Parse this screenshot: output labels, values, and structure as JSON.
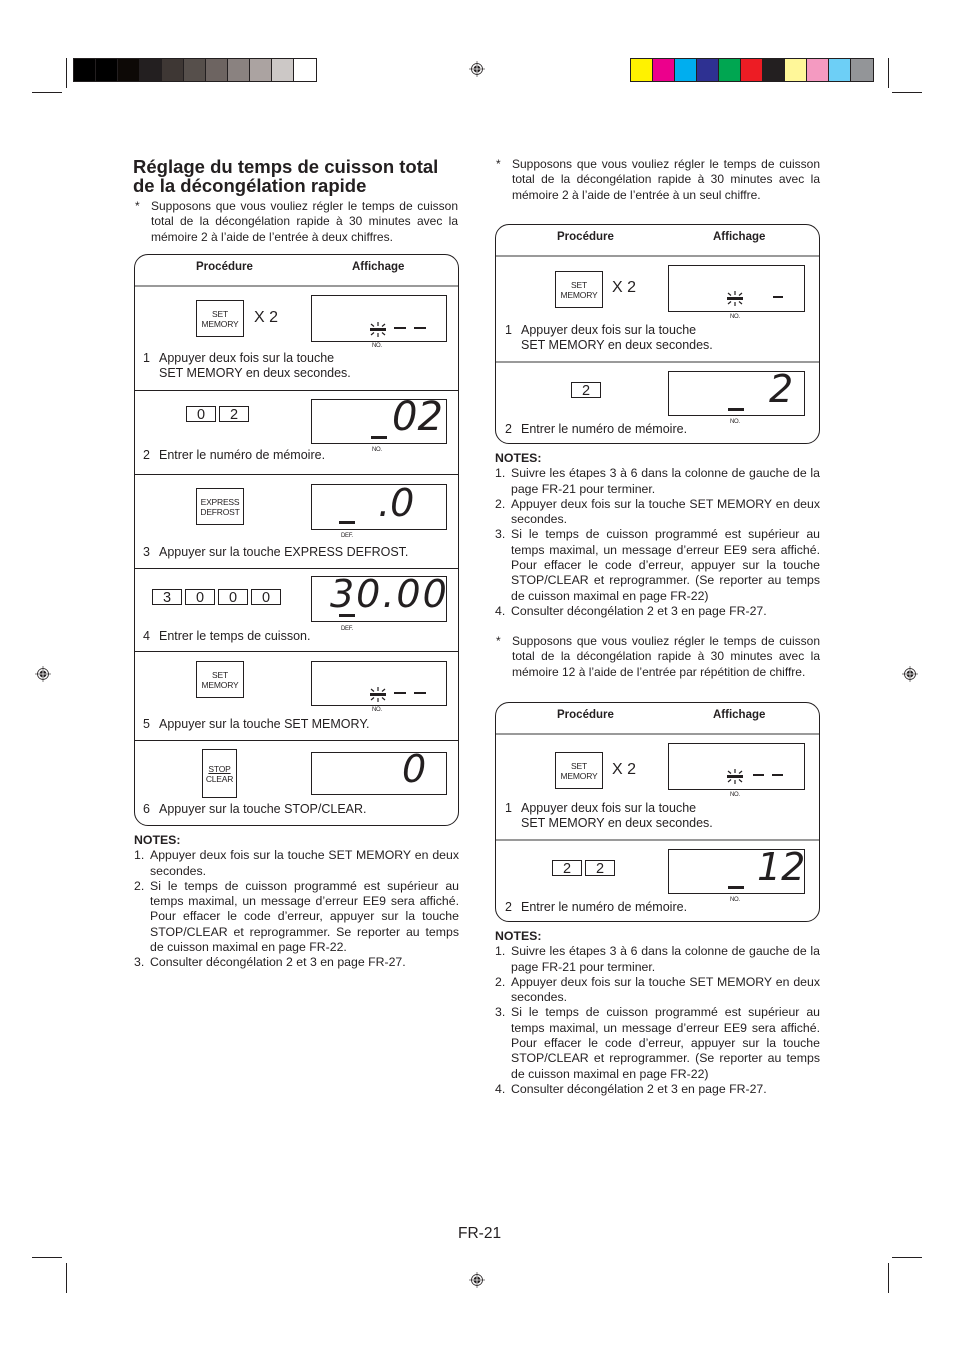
{
  "print_marks": {
    "gray_swatches": [
      "#000000",
      "#000000",
      "#0d0906",
      "#231f20",
      "#3e3734",
      "#564f4b",
      "#6d6461",
      "#8a8280",
      "#aba3a1",
      "#ccc8c6",
      "#ffffff"
    ],
    "color_swatches": [
      "#fff200",
      "#ec008c",
      "#00aeef",
      "#2e3192",
      "#00a651",
      "#ed1c24",
      "#231f20",
      "#fff799",
      "#f49ac1",
      "#6dcff6",
      "#939598"
    ]
  },
  "left": {
    "title": "Réglage du temps de cuisson total de la décongélation rapide",
    "intro_star": "*",
    "intro": "Supposons que vous vouliez régler le temps de cuisson total de la décongélation rapide à 30 minutes avec la mémoire 2 à l’aide de l’entrée à deux chiffres.",
    "table": {
      "col_procedure": "Procédure",
      "col_display": "Affichage",
      "steps": [
        {
          "key": [
            "SET",
            "MEMORY"
          ],
          "multiplier": "X 2",
          "display": "blink--",
          "label": "NO.",
          "num": "1",
          "text1": "Appuyer deux fois sur la touche",
          "text2": "SET MEMORY en deux secondes."
        },
        {
          "digits": [
            "0",
            "2"
          ],
          "display": "02",
          "label": "NO.",
          "num": "2",
          "text1": "Entrer le numéro de mémoire."
        },
        {
          "key": [
            "EXPRESS",
            "DEFROST"
          ],
          "display": ".0",
          "label": "DEF.",
          "num": "3",
          "text1": "Appuyer sur la touche EXPRESS DEFROST."
        },
        {
          "digits": [
            "3",
            "0",
            "0",
            "0"
          ],
          "display": "30.00",
          "label": "DEF.",
          "num": "4",
          "text1": "Entrer le temps de cuisson."
        },
        {
          "key": [
            "SET",
            "MEMORY"
          ],
          "display": "blink--",
          "label": "NO.",
          "num": "5",
          "text1": "Appuyer sur la touche SET MEMORY."
        },
        {
          "key": [
            "STOP",
            "CLEAR"
          ],
          "display": "0",
          "num": "6",
          "text1": "Appuyer sur la touche STOP/CLEAR."
        }
      ]
    },
    "notes_title": "NOTES:",
    "notes": [
      {
        "num": "1.",
        "text": "Appuyer deux fois sur la touche SET MEMORY en deux secondes."
      },
      {
        "num": "2.",
        "text": "Si le temps de cuisson programmé est supérieur au temps maximal, un message d’erreur EE9 sera affiché. Pour effacer le code d’erreur, appuyer sur la touche STOP/CLEAR et reprogrammer. Se reporter au temps de cuisson maximal en page FR-22."
      },
      {
        "num": "3.",
        "text": "Consulter décongélation 2 et 3 en page FR-27."
      }
    ]
  },
  "right": {
    "section1": {
      "intro_star": "*",
      "intro": "Supposons que vous vouliez régler le temps de cuisson total de la décongélation rapide à 30 minutes avec la mémoire 2 à l’aide de l’entrée à un seul chiffre.",
      "col_procedure": "Procédure",
      "col_display": "Affichage",
      "steps": [
        {
          "key": [
            "SET",
            "MEMORY"
          ],
          "multiplier": "X 2",
          "display": "blink-",
          "label": "NO.",
          "num": "1",
          "text1": "Appuyer deux fois sur la touche",
          "text2": "SET MEMORY en deux secondes."
        },
        {
          "digits": [
            "2"
          ],
          "display": "2",
          "label": "NO.",
          "num": "2",
          "text1": "Entrer le numéro de mémoire."
        }
      ],
      "notes_title": "NOTES:",
      "notes": [
        {
          "num": "1.",
          "text": "Suivre les étapes 3 à 6  dans la colonne de gauche de la page FR-21 pour terminer."
        },
        {
          "num": "2.",
          "text": "Appuyer deux fois sur la touche SET MEMORY en deux secondes."
        },
        {
          "num": "3.",
          "text": "Si le temps de cuisson programmé est supérieur au temps maximal, un message d’erreur EE9 sera affiché. Pour effacer le code d’erreur, appuyer sur la touche STOP/CLEAR et reprogrammer. (Se reporter au temps de cuisson maximal en page FR-22)"
        },
        {
          "num": "4.",
          "text": "Consulter décongélation 2 et 3 en page FR-27."
        }
      ]
    },
    "section2": {
      "intro_star": "*",
      "intro": "Supposons que vous vouliez régler le temps de cuisson total de la décongélation rapide à 30 minutes avec la mémoire 12 à l’aide de l’entrée par répétition de chiffre.",
      "col_procedure": "Procédure",
      "col_display": "Affichage",
      "steps": [
        {
          "key": [
            "SET",
            "MEMORY"
          ],
          "multiplier": "X 2",
          "display": "blink--",
          "label": "NO.",
          "num": "1",
          "text1": "Appuyer deux fois sur la touche",
          "text2": "SET MEMORY en deux secondes."
        },
        {
          "digits": [
            "2",
            "2"
          ],
          "display": "12",
          "label": "NO.",
          "num": "2",
          "text1": "Entrer le numéro de mémoire."
        }
      ],
      "notes_title": "NOTES:",
      "notes": [
        {
          "num": "1.",
          "text": "Suivre les étapes 3 à 6  dans la colonne de gauche de la page  FR-21 pour terminer."
        },
        {
          "num": "2.",
          "text": "Appuyer deux fois sur la touche SET MEMORY en deux secondes."
        },
        {
          "num": "3.",
          "text": "Si le temps de cuisson programmé est supérieur au temps maximal, un message d’erreur EE9 sera affiché. Pour effacer le code d’erreur, appuyer sur la touche STOP/CLEAR et reprogrammer. (Se reporter au temps de cuisson maximal en page FR-22)"
        },
        {
          "num": "4.",
          "text": "Consulter décongélation 2 et 3 en page FR-27."
        }
      ]
    }
  },
  "footer": {
    "page_number": "FR-21"
  }
}
